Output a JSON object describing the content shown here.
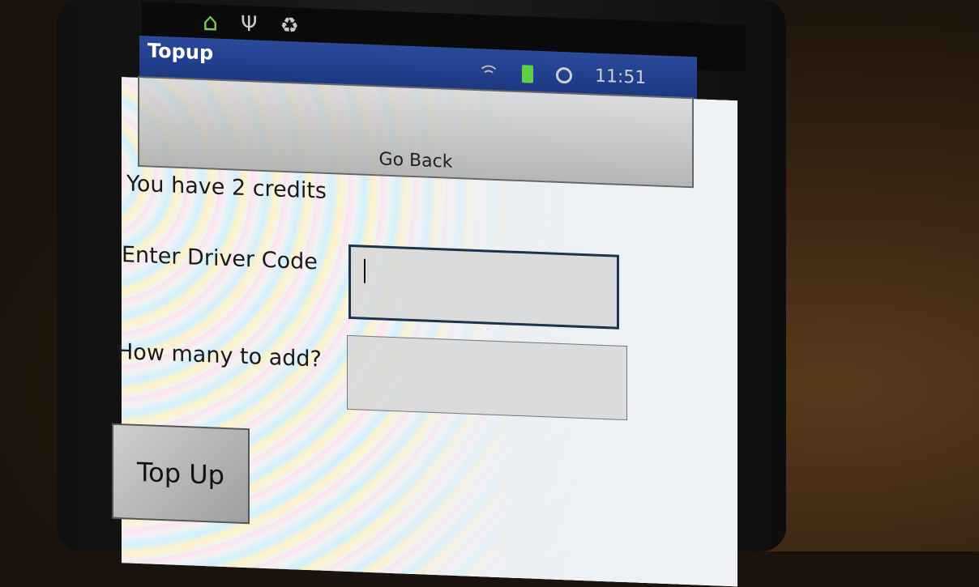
{
  "statusbar": {
    "time": "11:51",
    "icons": [
      "home-icon",
      "usb-icon",
      "recycle-icon",
      "wifi-icon",
      "battery-charging-icon",
      "alarm-icon"
    ]
  },
  "app": {
    "title": "Topup"
  },
  "buttons": {
    "go_back": "Go Back",
    "top_up": "Top Up"
  },
  "credits_text": "You have 2 credits",
  "form": {
    "driver_code_label": "Enter Driver Code",
    "driver_code_value": "",
    "amount_label": "How many to add?",
    "amount_value": ""
  },
  "colors": {
    "titlebar": "#1b3680",
    "statusbar_icon_green": "#7fc55a"
  }
}
